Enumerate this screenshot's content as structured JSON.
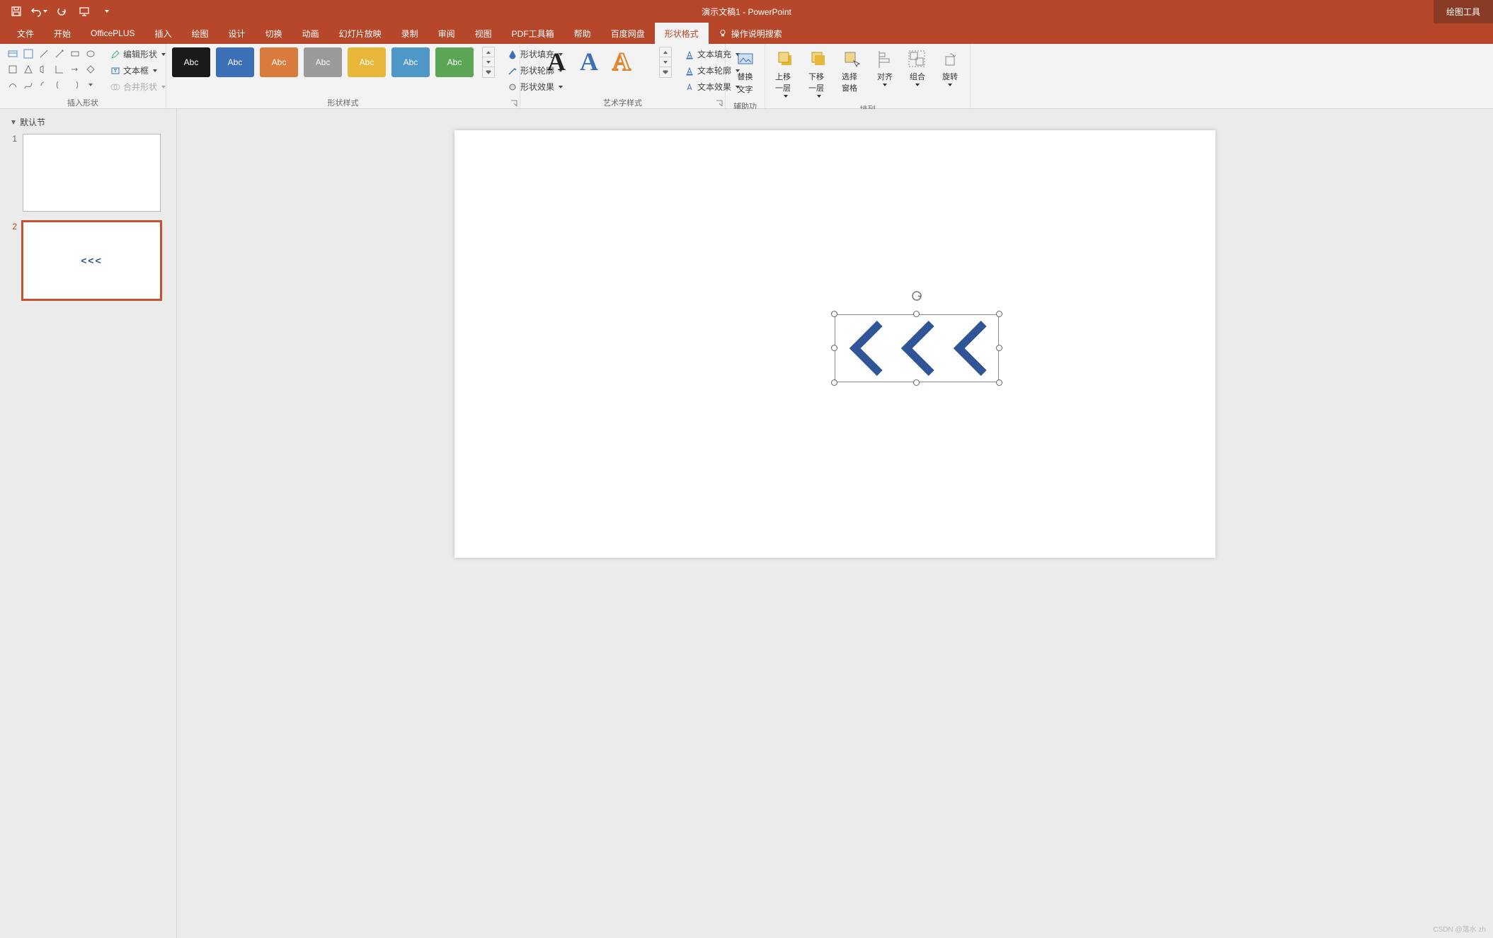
{
  "title": "演示文稿1  -  PowerPoint",
  "context_tab": "绘图工具",
  "tabs": [
    "文件",
    "开始",
    "OfficePLUS",
    "插入",
    "绘图",
    "设计",
    "切换",
    "动画",
    "幻灯片放映",
    "录制",
    "审阅",
    "视图",
    "PDF工具箱",
    "帮助",
    "百度网盘",
    "形状格式"
  ],
  "tell_me": "操作说明搜索",
  "groups": {
    "insert": {
      "label": "插入形状",
      "edit_shape": "编辑形状",
      "textbox": "文本框",
      "merge": "合并形状"
    },
    "styles": {
      "label": "形状样式",
      "swatch_text": "Abc",
      "swatch_colors": [
        "#1a1a1a",
        "#3b6fb6",
        "#d97b3c",
        "#9a9a9a",
        "#e8b73a",
        "#4f97c9",
        "#5aa556"
      ],
      "fill": "形状填充",
      "outline": "形状轮廓",
      "effects": "形状效果"
    },
    "wordart": {
      "label": "艺术字样式",
      "fill": "文本填充",
      "outline": "文本轮廓",
      "effects": "文本效果",
      "glyph": "A"
    },
    "access": {
      "label": "辅助功能",
      "alt1": "替换",
      "alt2": "文字"
    },
    "arrange": {
      "label": "排列",
      "fwd": "上移一层",
      "back": "下移一层",
      "pane": "选择窗格",
      "align": "对齐",
      "group": "组合",
      "rotate": "旋转"
    }
  },
  "section": "默认节",
  "thumbs": [
    1,
    2
  ],
  "watermark": "CSDN @落水 zh"
}
